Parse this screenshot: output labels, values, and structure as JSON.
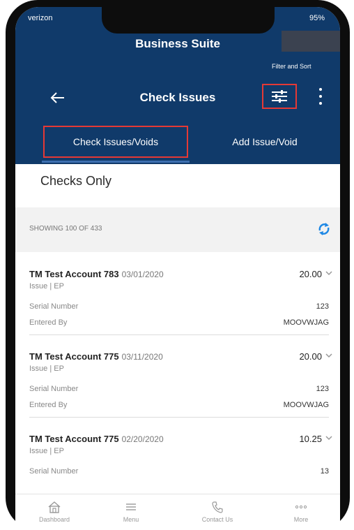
{
  "status": {
    "carrier": "verizon",
    "battery": "95%"
  },
  "app": {
    "title": "Business Suite"
  },
  "toolbar": {
    "filter_label": "Filter and Sort",
    "title": "Check Issues"
  },
  "tabs": [
    {
      "label": "Check Issues/Voids",
      "active": true
    },
    {
      "label": "Add Issue/Void",
      "active": false
    }
  ],
  "filter": {
    "label": "Checks Only"
  },
  "summary": {
    "showing": "SHOWING 100 OF 433"
  },
  "checks": [
    {
      "account": "TM Test Account 783",
      "date": "03/01/2020",
      "amount": "20.00",
      "type": "Issue | EP",
      "serial_label": "Serial Number",
      "serial": "123",
      "entered_label": "Entered By",
      "entered_by": "MOOVWJAG"
    },
    {
      "account": "TM Test Account 775",
      "date": "03/11/2020",
      "amount": "20.00",
      "type": "Issue | EP",
      "serial_label": "Serial Number",
      "serial": "123",
      "entered_label": "Entered By",
      "entered_by": "MOOVWJAG"
    },
    {
      "account": "TM Test Account 775",
      "date": "02/20/2020",
      "amount": "10.25",
      "type": "Issue | EP",
      "serial_label": "Serial Number",
      "serial": "13"
    }
  ],
  "bottom_nav": [
    {
      "label": "Dashboard",
      "icon": "home-icon"
    },
    {
      "label": "Menu",
      "icon": "menu-icon"
    },
    {
      "label": "Contact Us",
      "icon": "phone-icon"
    },
    {
      "label": "More",
      "icon": "more-icon"
    }
  ],
  "colors": {
    "header": "#103a6a",
    "highlight": "#e53935",
    "accent": "#1e88e5"
  }
}
